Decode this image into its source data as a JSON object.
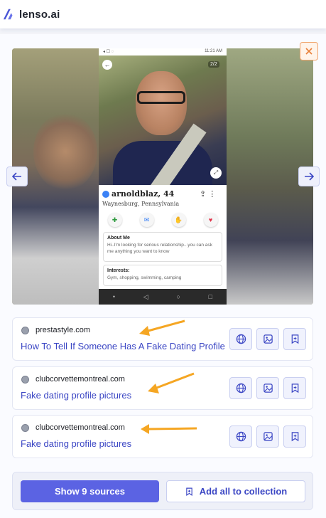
{
  "app": {
    "brand": "lenso.ai",
    "accent": "#5b63e3",
    "link_color": "#3b46c4",
    "annotation_color": "#f5a623"
  },
  "viewer": {
    "close_icon": "close-icon",
    "phone": {
      "status_time": "11:21 AM",
      "photo_counter": "2/2",
      "profile_name": "arnoldblaz, 44",
      "profile_location": "Waynesburg, Pennsylvania",
      "about_title": "About Me",
      "about_text": "Hi..I'm looking for serious relationship...you can ask me anything you want to know",
      "interests_title": "Interests:",
      "interests_text": "Gym, shopping, swimming, camping"
    }
  },
  "results": [
    {
      "domain": "prestastyle.com",
      "title": "How To Tell If Someone Has A Fake Dating Profile"
    },
    {
      "domain": "clubcorvettemontreal.com",
      "title": "Fake dating profile pictures"
    },
    {
      "domain": "clubcorvettemontreal.com",
      "title": "Fake dating profile pictures"
    }
  ],
  "footer": {
    "show_sources": "Show 9 sources",
    "add_all": "Add all to collection"
  }
}
